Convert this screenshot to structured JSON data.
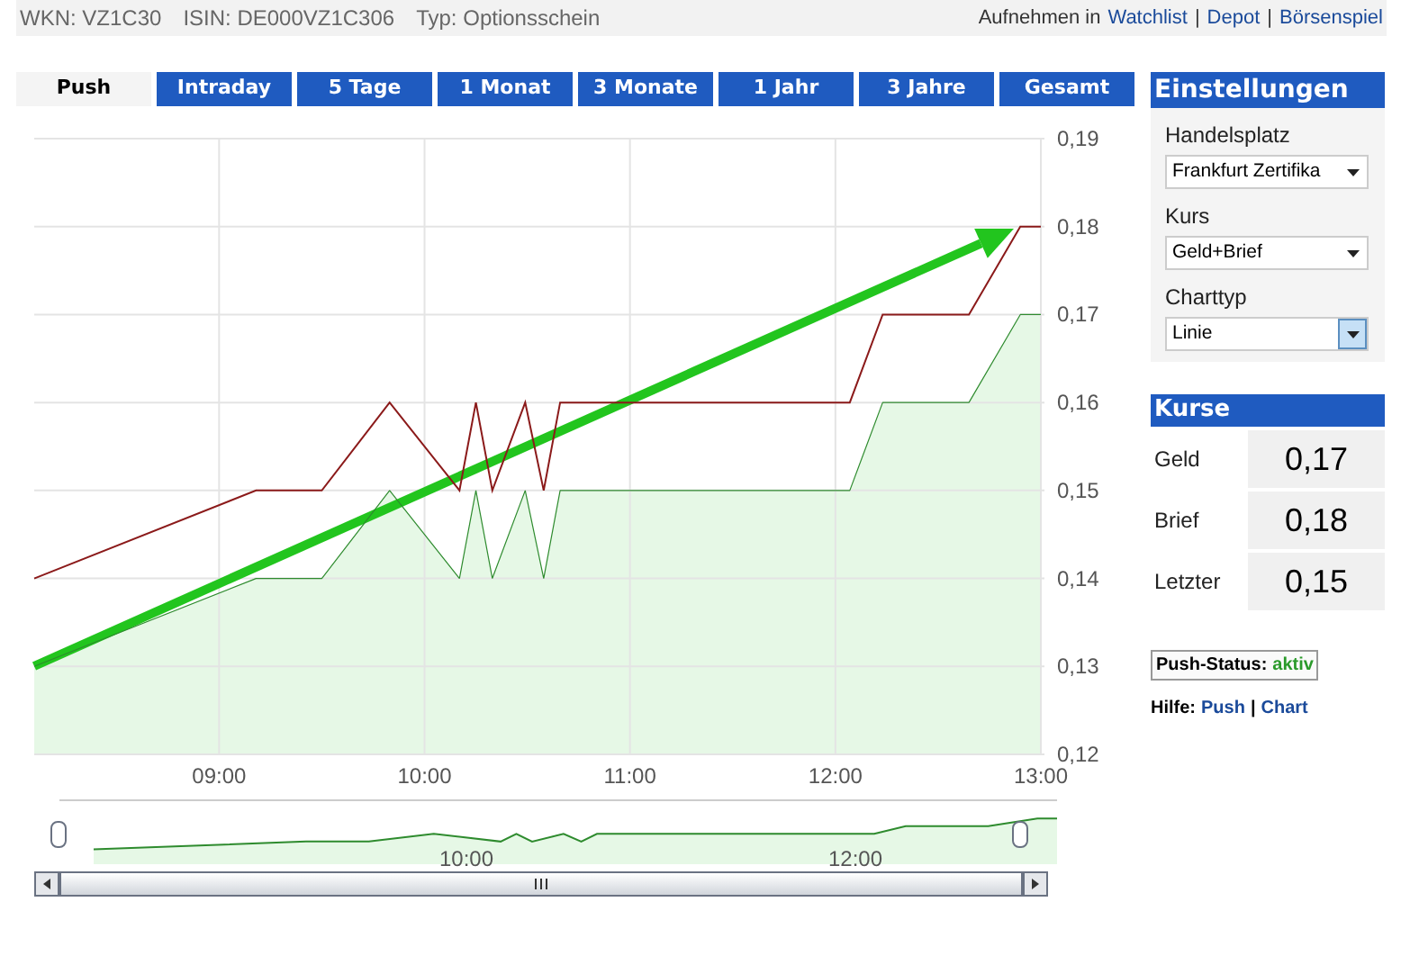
{
  "header": {
    "facts": [
      "WKN: VZ1C30",
      "ISIN: DE000VZ1C306",
      "Typ: Optionsschein"
    ],
    "add_label": "Aufnehmen in",
    "links": [
      "Watchlist",
      "Depot",
      "Börsenspiel"
    ],
    "separator": "|"
  },
  "tabs": [
    {
      "label": "Push",
      "selected": true
    },
    {
      "label": "Intraday",
      "selected": false
    },
    {
      "label": "5 Tage",
      "selected": false
    },
    {
      "label": "1 Monat",
      "selected": false
    },
    {
      "label": "3 Monate",
      "selected": false
    },
    {
      "label": "1 Jahr",
      "selected": false
    },
    {
      "label": "3 Jahre",
      "selected": false
    },
    {
      "label": "Gesamt",
      "selected": false
    }
  ],
  "chart": {
    "chart_data": {
      "type": "line",
      "grid": true,
      "xlim": [
        8.1,
        13.0
      ],
      "x": [
        8.1,
        9.18,
        9.5,
        9.83,
        10.17,
        10.25,
        10.33,
        10.49,
        10.58,
        10.66,
        12.07,
        12.23,
        12.65,
        12.9,
        13.0
      ],
      "series": [
        {
          "color": "#8b1a1a",
          "values": [
            0.14,
            0.15,
            0.15,
            0.16,
            0.15,
            0.16,
            0.15,
            0.16,
            0.15,
            0.16,
            0.16,
            0.17,
            0.17,
            0.18,
            0.18
          ]
        },
        {
          "type": "area",
          "color": "#2e8b2e",
          "values": [
            0.13,
            0.14,
            0.14,
            0.15,
            0.14,
            0.15,
            0.14,
            0.15,
            0.14,
            0.15,
            0.15,
            0.16,
            0.16,
            0.17,
            0.17
          ]
        }
      ],
      "ylim": [
        0.12,
        0.19
      ],
      "yticks": [
        {
          "value": 0.12,
          "label": "0,12"
        },
        {
          "value": 0.13,
          "label": "0,13"
        },
        {
          "value": 0.14,
          "label": "0,14"
        },
        {
          "value": 0.15,
          "label": "0,15"
        },
        {
          "value": 0.16,
          "label": "0,16"
        },
        {
          "value": 0.17,
          "label": "0,17"
        },
        {
          "value": 0.18,
          "label": "0,18"
        },
        {
          "value": 0.19,
          "label": "0,19"
        }
      ],
      "xticks": [
        {
          "value": 9,
          "label": "09:00"
        },
        {
          "value": 10,
          "label": "10:00"
        },
        {
          "value": 11,
          "label": "11:00"
        },
        {
          "value": 12,
          "label": "12:00"
        },
        {
          "value": 13,
          "label": "13:00"
        }
      ]
    }
  },
  "navigator": {
    "labels": [
      "10:00",
      "12:00"
    ]
  },
  "settings": {
    "title": "Einstellungen",
    "fields": [
      {
        "label": "Handelsplatz",
        "value": "Frankfurt Zertifika",
        "highlighted": false
      },
      {
        "label": "Kurs",
        "value": "Geld+Brief",
        "highlighted": false
      },
      {
        "label": "Charttyp",
        "value": "Linie",
        "highlighted": true
      }
    ]
  },
  "quotes": {
    "title": "Kurse",
    "rows": [
      {
        "label": "Geld",
        "value": "0,17"
      },
      {
        "label": "Brief",
        "value": "0,18"
      },
      {
        "label": "Letzter",
        "value": "0,15"
      }
    ]
  },
  "push_status": {
    "label": "Push-Status:",
    "value": "aktiv"
  },
  "help": {
    "label": "Hilfe:",
    "links": [
      "Push",
      "Chart"
    ],
    "separator": "|"
  }
}
